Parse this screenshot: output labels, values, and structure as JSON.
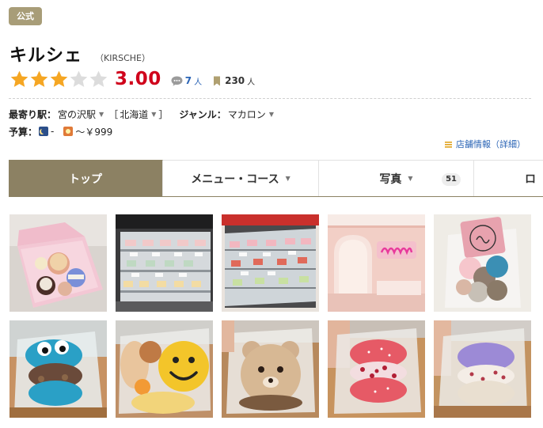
{
  "badge": {
    "label": "公式"
  },
  "store": {
    "name": "キルシェ",
    "reading": "（KIRSCHE）"
  },
  "rating": {
    "score": "3.00",
    "stars_filled": 3,
    "stars_total": 5,
    "review_count": "7",
    "review_unit": "人",
    "bookmark_count": "230",
    "bookmark_unit": "人"
  },
  "info": {
    "station_label": "最寄り駅：",
    "station_value": "宮の沢駅",
    "region_open": "［",
    "region_value": "北海道",
    "region_close": "］",
    "genre_label": "ジャンル：",
    "genre_value": "マカロン",
    "budget_label": "予算：",
    "budget_night_value": "-",
    "budget_day_value": "～￥999",
    "shop_info_link": "店舗情報（詳細）"
  },
  "tabs": [
    {
      "label": "トップ",
      "active": true
    },
    {
      "label": "メニュー・コース"
    },
    {
      "label": "写真",
      "count": "51"
    },
    {
      "label": "ロ"
    }
  ],
  "photos": [
    "pink-gift-box-macarons",
    "display-case-shelves",
    "display-case-shelves-2",
    "pink-storefront-neon",
    "kirsche-bag-macarons",
    "blue-character-macaron",
    "smiley-face-macaron",
    "bear-face-macaron",
    "red-berry-macaron",
    "purple-macaron"
  ],
  "colors": {
    "accent": "#8c8163",
    "badge": "#a89d78",
    "score": "#d0021b",
    "star": "#f5a623",
    "link": "#2a64b5"
  }
}
